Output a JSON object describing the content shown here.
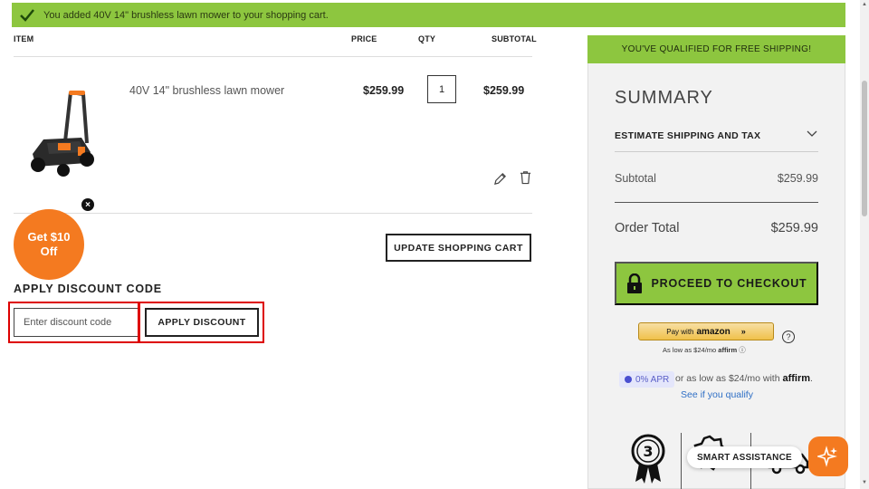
{
  "banner": {
    "message": "You added 40V 14\" brushless lawn mower to your shopping cart."
  },
  "cart": {
    "headers": {
      "item": "ITEM",
      "price": "PRICE",
      "qty": "QTY",
      "subtotal": "SUBTOTAL"
    },
    "item": {
      "name": "40V 14\" brushless lawn mower",
      "price": "$259.99",
      "qty": "1",
      "subtotal": "$259.99"
    },
    "update_label": "UPDATE SHOPPING CART"
  },
  "promo": {
    "line1": "Get $10",
    "line2": "Off"
  },
  "discount": {
    "title": "APPLY DISCOUNT CODE",
    "placeholder": "Enter discount code",
    "button": "APPLY DISCOUNT"
  },
  "summary": {
    "shipping_banner": "YOU'VE QUALIFIED FOR FREE SHIPPING!",
    "title": "SUMMARY",
    "estimate_label": "ESTIMATE SHIPPING AND TAX",
    "subtotal_label": "Subtotal",
    "subtotal_value": "$259.99",
    "total_label": "Order Total",
    "total_value": "$259.99",
    "checkout_label": "PROCEED TO CHECKOUT"
  },
  "amazon": {
    "prefix": "Pay with",
    "brand": "amazon",
    "arrows": "»",
    "as_low": "As low as $24/mo",
    "affirm_mark": "affirm"
  },
  "affirm": {
    "apr": "0% APR",
    "text": "or as low as $24/mo with",
    "brand": "affirm",
    "period": ".",
    "qualify_link": "See if you qualify"
  },
  "assistant": {
    "label": "SMART ASSISTANCE"
  },
  "badges": {
    "first_number": "3"
  },
  "colors": {
    "green": "#8dc63f",
    "orange": "#f47a20",
    "highlight": "#dd0000"
  }
}
